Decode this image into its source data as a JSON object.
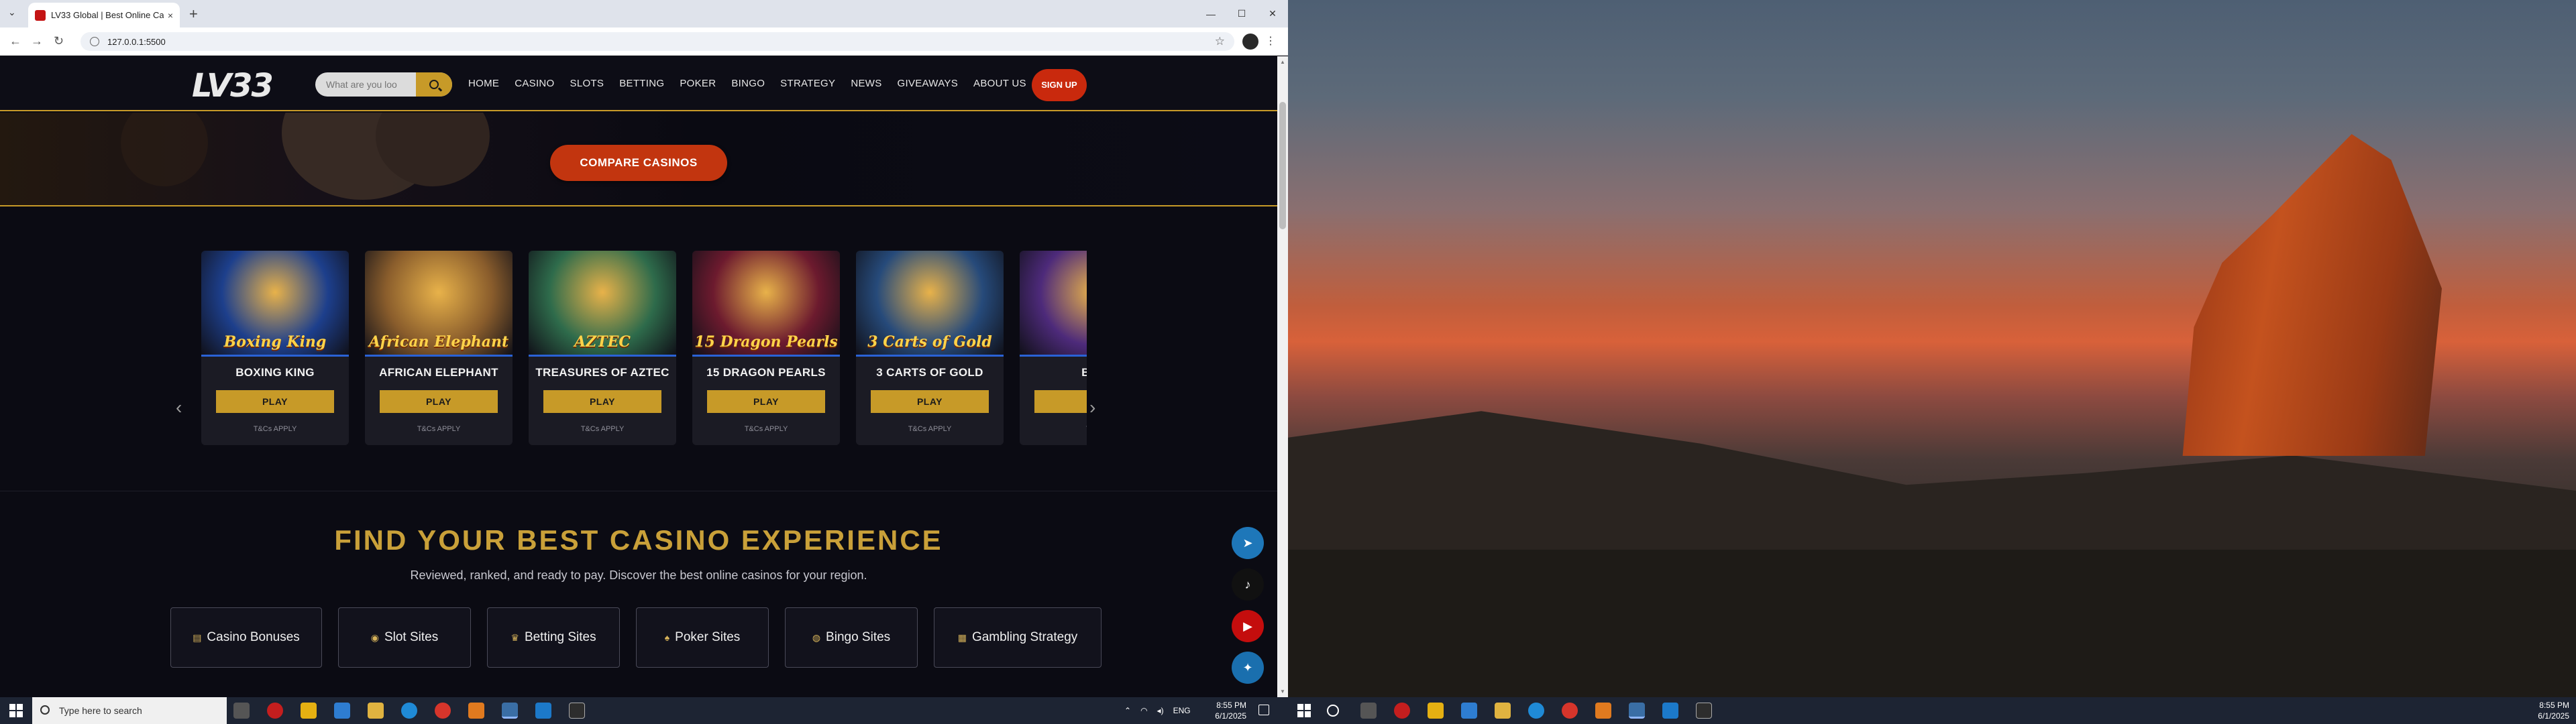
{
  "browser": {
    "tab_title": "LV33 Global | Best Online Casino",
    "tab_close": "×",
    "new_tab": "+",
    "url": "127.0.0.1:5500",
    "window_controls": [
      "—",
      "☐",
      "✕"
    ]
  },
  "site": {
    "logo": "LV33",
    "search_placeholder": "What are you loo",
    "nav": [
      "HOME",
      "CASINO",
      "SLOTS",
      "BETTING",
      "POKER",
      "BINGO",
      "STRATEGY",
      "NEWS",
      "GIVEAWAYS",
      "ABOUT US"
    ],
    "signup": "SIGN UP",
    "compare_button": "COMPARE CASINOS",
    "games": [
      {
        "name": "BOXING KING",
        "play": "PLAY",
        "tc": "T&Cs APPLY",
        "art": "Boxing King",
        "bg": "#1d3f8c"
      },
      {
        "name": "AFRICAN ELEPHANT",
        "play": "PLAY",
        "tc": "T&Cs APPLY",
        "art": "African Elephant",
        "bg": "#8a5d2c"
      },
      {
        "name": "TREASURES OF AZTEC",
        "play": "PLAY",
        "tc": "T&Cs APPLY",
        "art": "AZTEC",
        "bg": "#2e6b4b"
      },
      {
        "name": "15 DRAGON PEARLS",
        "play": "PLAY",
        "tc": "T&Cs APPLY",
        "art": "15 Dragon Pearls",
        "bg": "#6c1a2e"
      },
      {
        "name": "3 CARTS OF GOLD",
        "play": "PLAY",
        "tc": "T&Cs APPLY",
        "art": "3 Carts of Gold",
        "bg": "#264a7a"
      },
      {
        "name": "BUZ",
        "play": "PL",
        "tc": "T&C",
        "art": "",
        "bg": "#4d2a7a"
      }
    ],
    "section_title": "FIND YOUR BEST CASINO EXPERIENCE",
    "section_subtitle": "Reviewed, ranked, and ready to pay. Discover the best online casinos for your region.",
    "categories": [
      {
        "label": "Casino Bonuses",
        "icon": "▤"
      },
      {
        "label": "Slot Sites",
        "icon": "◉"
      },
      {
        "label": "Betting Sites",
        "icon": "♛"
      },
      {
        "label": "Poker Sites",
        "icon": "♠"
      },
      {
        "label": "Bingo Sites",
        "icon": "◍"
      },
      {
        "label": "Gambling Strategy",
        "icon": "▦"
      }
    ],
    "social": [
      {
        "name": "telegram",
        "glyph": "➤",
        "color": "#1e77b9"
      },
      {
        "name": "tiktok",
        "glyph": "♪",
        "color": "#111111"
      },
      {
        "name": "youtube",
        "glyph": "▶",
        "color": "#c40d0d"
      },
      {
        "name": "twitter",
        "glyph": "✦",
        "color": "#1a6fae"
      }
    ]
  },
  "taskbar_left": {
    "search_placeholder": "Type here to search",
    "language": "ENG",
    "time": "8:55 PM",
    "date": "6/1/2025"
  },
  "taskbar_right": {
    "time": "8:55 PM",
    "date": "6/1/2025"
  }
}
